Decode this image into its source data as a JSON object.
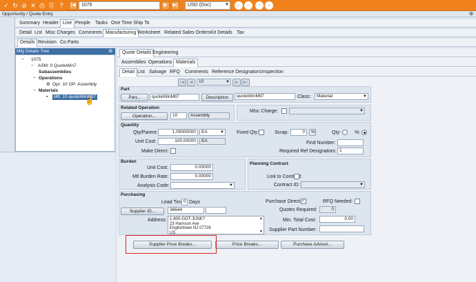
{
  "toolbar": {
    "record_value": "1075",
    "currency_value": "USD (Doc)"
  },
  "window": {
    "title": "Opportunity / Quote Entry"
  },
  "top_tabs": [
    "Summary",
    "Header",
    "Line",
    "People",
    "Tasks",
    "One Time Ship To"
  ],
  "line_tabs": [
    "Detail",
    "List",
    "Misc Charges",
    "Comments",
    "Manufacturing",
    "Worksheet",
    "Related Sales Orders",
    "Kit Details",
    "Tax"
  ],
  "mfg_tabs": [
    "Details",
    "Revision",
    "Co Parts"
  ],
  "tree": {
    "title": "Mfg Details Tree",
    "nodes": [
      {
        "label": "1075",
        "bold": false
      },
      {
        "label": "ASM: 0 QuoteWin7",
        "bold": false
      },
      {
        "label": "Subassemblies",
        "bold": true
      },
      {
        "label": "Operations",
        "bold": true
      },
      {
        "label": "Opr: 10 OP: Assembly",
        "bold": false
      },
      {
        "label": "Materials",
        "bold": true
      },
      {
        "label": "Mtl: 10 quoteWinMtl7",
        "bold": false
      }
    ]
  },
  "right_tabs": {
    "level1": [
      "Quote Details",
      "Engineering"
    ],
    "level2": [
      "Assemblies",
      "Operations",
      "Materials"
    ],
    "level3": [
      "Detail",
      "List",
      "Salvage",
      "RFQ",
      "Comments",
      "Reference Designators",
      "Inspection"
    ]
  },
  "nav": {
    "value": "10"
  },
  "part": {
    "section": "Part",
    "part_button": "Part...",
    "part_value": "quoteWinMtl7",
    "desc_button": "Description",
    "desc_value": "quoteWinMtl7",
    "class_label": "Class:",
    "class_value": "Material"
  },
  "related_op": {
    "section": "Related Operation",
    "op_button": "Operation...",
    "op_value": "10",
    "op_desc": "Assembly"
  },
  "misc": {
    "label": "Misc Charge:"
  },
  "quantity": {
    "section": "Quantity",
    "qty_label": "Qty/Parent:",
    "qty_value": "1.00000000",
    "qty_uom": "EA",
    "cost_label": "Unit Cost:",
    "cost_value": "100.00000",
    "cost_uom": "EA",
    "make_direct": "Make Direct:",
    "fixed_qty": "Fixed Qty:",
    "scrap_label": "Scrap:",
    "scrap_value": "0",
    "scrap_unit": "%",
    "qty_radio": "Qty:",
    "pct_radio": "%:",
    "find_number": "Find Number:",
    "ref_des": "Required Ref Designators:",
    "ref_des_value": "1"
  },
  "burden": {
    "section": "Burden",
    "unit_cost_label": "Unit Cost:",
    "unit_cost_value": "0.00000",
    "rate_label": "Mtl Burden Rate:",
    "rate_value": "0.00000",
    "analysis_label": "Analysis Code:"
  },
  "planning": {
    "section": "Planning Contract",
    "link_label": "Link to Contract:",
    "contract_label": "Contract ID:"
  },
  "purchasing": {
    "section": "Purchasing",
    "lead_label": "Lead Time:",
    "lead_value": "0",
    "lead_unit": "Days",
    "supplier_button": "Supplier ID...",
    "supplier_value": "36644",
    "address_label": "Address:",
    "address_lines": [
      "1-800-GOT-JUNK?",
      "23 Harrison Ave",
      "Englishtown NJ 07726",
      "US"
    ],
    "purchase_direct": "Purchase Direct:",
    "rfq_needed": "RFQ Needed:",
    "quotes_required": "Quotes Required:",
    "quotes_value": "0",
    "min_cost_label": "Min. Total Cost:",
    "min_cost_value": "0.00",
    "supplier_part": "Supplier Part Number:"
  },
  "bottom_buttons": {
    "supplier_price_breaks": "Supplier Price Breaks...",
    "price_breaks": "Price Breaks...",
    "purchase_advisor": "Purchase Advisor..."
  }
}
